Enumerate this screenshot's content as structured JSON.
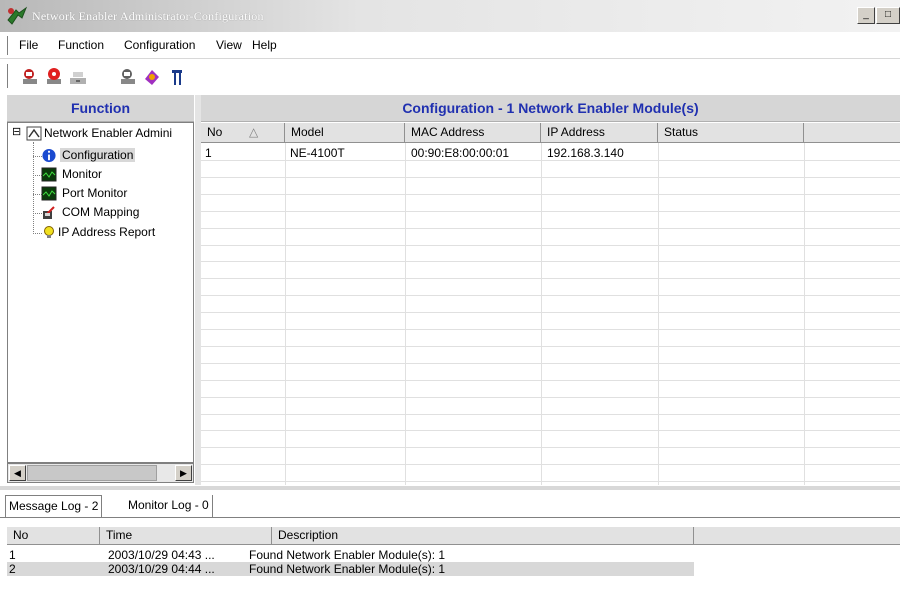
{
  "window": {
    "title": "Network Enabler Administrator-Configuration",
    "controls": [
      "_",
      "□"
    ]
  },
  "menu": [
    {
      "label": "File"
    },
    {
      "label": "Function"
    },
    {
      "label": "Configuration"
    },
    {
      "label": "View"
    },
    {
      "label": "Help"
    }
  ],
  "toolbar": {
    "icons": [
      "search-network-icon",
      "broadcast-search-icon",
      "unlock-icon",
      "ip-search-icon",
      "configure-icon",
      "exit-icon"
    ]
  },
  "left_panel": {
    "header": "Function",
    "tree": {
      "root": "Network Enabler Admini",
      "root_toggle": "⊟",
      "items": [
        {
          "label": "Configuration",
          "icon": "info-icon",
          "selected": true
        },
        {
          "label": "Monitor",
          "icon": "monitor-icon"
        },
        {
          "label": "Port Monitor",
          "icon": "port-monitor-icon"
        },
        {
          "label": "COM Mapping",
          "icon": "com-mapping-icon"
        },
        {
          "label": "IP Address Report",
          "icon": "ip-report-icon"
        }
      ]
    },
    "scroll_left": "◀",
    "scroll_right": "▶"
  },
  "right_panel": {
    "header": "Configuration - 1 Network Enabler Module(s)",
    "columns": [
      "No",
      "Model",
      "MAC Address",
      "IP Address",
      "Status"
    ],
    "sort_indicator": "△",
    "rows": [
      {
        "no": "1",
        "model": "NE-4100T",
        "mac": "00:90:E8:00:00:01",
        "ip": "192.168.3.140",
        "status": ""
      }
    ]
  },
  "log": {
    "tabs": [
      "Message Log - 2",
      "Monitor Log - 0"
    ],
    "columns": [
      "No",
      "Time",
      "Description"
    ],
    "rows": [
      {
        "no": "1",
        "time": "2003/10/29 04:43 ...",
        "description": "Found Network Enabler Module(s): 1"
      },
      {
        "no": "2",
        "time": "2003/10/29 04:44 ...",
        "description": "Found Network Enabler Module(s): 1"
      }
    ]
  },
  "colors": {
    "header_text": "#2030b0",
    "panel_header_bg": "#d6d6d6",
    "selected_row_bg": "#d8d8d8"
  }
}
